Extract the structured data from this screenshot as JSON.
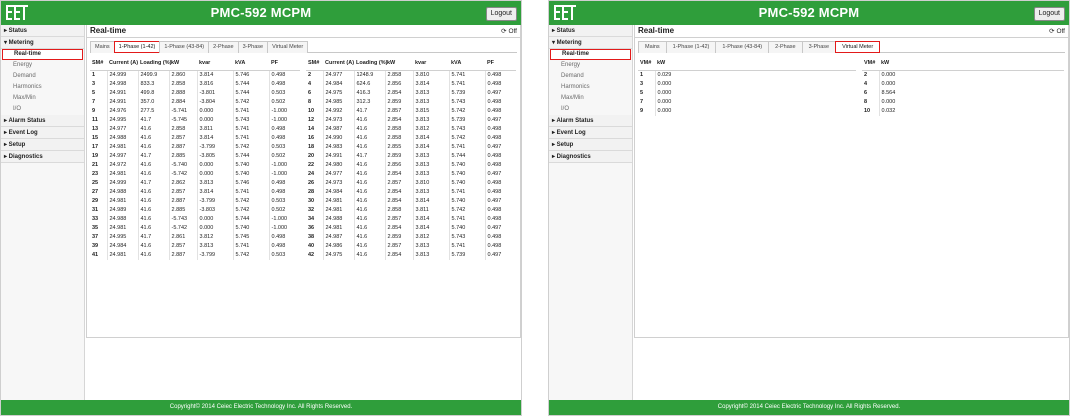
{
  "app": {
    "title": "PMC-592 MCPM",
    "logout_label": "Logout",
    "footer": "Copyright© 2014 Ceiec Electric Technology Inc. All Rights Reserved.",
    "brand_color": "#2f9e3b",
    "highlight_color": "#e21a1a"
  },
  "sidebar": {
    "status": "▸ Status",
    "metering": "▾ Metering",
    "metering_items": [
      "Real-time",
      "Energy",
      "Demand",
      "Harmonics",
      "Max/Min",
      "I/O"
    ],
    "alarm_status": "▸ Alarm Status",
    "event_log": "▸ Event Log",
    "setup": "▸ Setup",
    "diagnostics": "▸ Diagnostics"
  },
  "left": {
    "page_title": "Real-time",
    "refresh_label": "Off",
    "tabs": [
      "Mains",
      "1-Phase (1-42)",
      "1-Phase (43-84)",
      "2-Phase",
      "3-Phase",
      "Virtual Meter"
    ],
    "active_tab": "1-Phase (1-42)",
    "headers": [
      "SM#",
      "Current (A)",
      "Loading (%)",
      "kW",
      "kvar",
      "kVA",
      "PF"
    ],
    "rows": [
      [
        [
          "1",
          "24.999",
          "2499.9",
          "2.860",
          "3.814",
          "5.746",
          "0.498"
        ],
        [
          "2",
          "24.977",
          "1248.9",
          "2.858",
          "3.810",
          "5.741",
          "0.498"
        ]
      ],
      [
        [
          "3",
          "24.998",
          "833.3",
          "2.858",
          "3.816",
          "5.744",
          "0.498"
        ],
        [
          "4",
          "24.984",
          "624.6",
          "2.856",
          "3.814",
          "5.741",
          "0.498"
        ]
      ],
      [
        [
          "5",
          "24.991",
          "499.8",
          "2.888",
          "-3.801",
          "5.744",
          "0.503"
        ],
        [
          "6",
          "24.975",
          "416.3",
          "2.854",
          "3.813",
          "5.739",
          "0.497"
        ]
      ],
      [
        [
          "7",
          "24.991",
          "357.0",
          "2.884",
          "-3.804",
          "5.742",
          "0.502"
        ],
        [
          "8",
          "24.985",
          "312.3",
          "2.859",
          "3.813",
          "5.743",
          "0.498"
        ]
      ],
      [
        [
          "9",
          "24.976",
          "277.5",
          "-5.741",
          "0.000",
          "5.741",
          "-1.000"
        ],
        [
          "10",
          "24.992",
          "41.7",
          "2.857",
          "3.815",
          "5.742",
          "0.498"
        ]
      ],
      [
        [
          "11",
          "24.995",
          "41.7",
          "-5.745",
          "0.000",
          "5.743",
          "-1.000"
        ],
        [
          "12",
          "24.973",
          "41.6",
          "2.854",
          "3.813",
          "5.739",
          "0.497"
        ]
      ],
      [
        [
          "13",
          "24.977",
          "41.6",
          "2.858",
          "3.811",
          "5.741",
          "0.498"
        ],
        [
          "14",
          "24.987",
          "41.6",
          "2.858",
          "3.812",
          "5.743",
          "0.498"
        ]
      ],
      [
        [
          "15",
          "24.988",
          "41.6",
          "2.857",
          "3.814",
          "5.741",
          "0.498"
        ],
        [
          "16",
          "24.990",
          "41.6",
          "2.858",
          "3.814",
          "5.742",
          "0.498"
        ]
      ],
      [
        [
          "17",
          "24.981",
          "41.6",
          "2.887",
          "-3.799",
          "5.742",
          "0.503"
        ],
        [
          "18",
          "24.983",
          "41.6",
          "2.855",
          "3.814",
          "5.741",
          "0.497"
        ]
      ],
      [
        [
          "19",
          "24.997",
          "41.7",
          "2.885",
          "-3.805",
          "5.744",
          "0.502"
        ],
        [
          "20",
          "24.991",
          "41.7",
          "2.859",
          "3.813",
          "5.744",
          "0.498"
        ]
      ],
      [
        [
          "21",
          "24.972",
          "41.6",
          "-5.740",
          "0.000",
          "5.740",
          "-1.000"
        ],
        [
          "22",
          "24.980",
          "41.6",
          "2.856",
          "3.813",
          "5.740",
          "0.498"
        ]
      ],
      [
        [
          "23",
          "24.981",
          "41.6",
          "-5.742",
          "0.000",
          "5.740",
          "-1.000"
        ],
        [
          "24",
          "24.977",
          "41.6",
          "2.854",
          "3.813",
          "5.740",
          "0.497"
        ]
      ],
      [
        [
          "25",
          "24.999",
          "41.7",
          "2.862",
          "3.813",
          "5.746",
          "0.498"
        ],
        [
          "26",
          "24.973",
          "41.6",
          "2.857",
          "3.810",
          "5.740",
          "0.498"
        ]
      ],
      [
        [
          "27",
          "24.988",
          "41.6",
          "2.857",
          "3.814",
          "5.741",
          "0.498"
        ],
        [
          "28",
          "24.984",
          "41.6",
          "2.854",
          "3.813",
          "5.741",
          "0.498"
        ]
      ],
      [
        [
          "29",
          "24.981",
          "41.6",
          "2.887",
          "-3.799",
          "5.742",
          "0.503"
        ],
        [
          "30",
          "24.981",
          "41.6",
          "2.854",
          "3.814",
          "5.740",
          "0.497"
        ]
      ],
      [
        [
          "31",
          "24.989",
          "41.6",
          "2.885",
          "-3.803",
          "5.742",
          "0.502"
        ],
        [
          "32",
          "24.981",
          "41.6",
          "2.858",
          "3.811",
          "5.742",
          "0.498"
        ]
      ],
      [
        [
          "33",
          "24.988",
          "41.6",
          "-5.743",
          "0.000",
          "5.744",
          "-1.000"
        ],
        [
          "34",
          "24.988",
          "41.6",
          "2.857",
          "3.814",
          "5.741",
          "0.498"
        ]
      ],
      [
        [
          "35",
          "24.981",
          "41.6",
          "-5.742",
          "0.000",
          "5.740",
          "-1.000"
        ],
        [
          "36",
          "24.981",
          "41.6",
          "2.854",
          "3.814",
          "5.740",
          "0.497"
        ]
      ],
      [
        [
          "37",
          "24.995",
          "41.7",
          "2.861",
          "3.812",
          "5.745",
          "0.498"
        ],
        [
          "38",
          "24.987",
          "41.6",
          "2.859",
          "3.812",
          "5.743",
          "0.498"
        ]
      ],
      [
        [
          "39",
          "24.984",
          "41.6",
          "2.857",
          "3.813",
          "5.741",
          "0.498"
        ],
        [
          "40",
          "24.986",
          "41.6",
          "2.857",
          "3.813",
          "5.741",
          "0.498"
        ]
      ],
      [
        [
          "41",
          "24.981",
          "41.6",
          "2.887",
          "-3.799",
          "5.742",
          "0.503"
        ],
        [
          "42",
          "24.975",
          "41.6",
          "2.854",
          "3.813",
          "5.739",
          "0.497"
        ]
      ]
    ]
  },
  "right": {
    "page_title": "Real-time",
    "refresh_label": "Off",
    "tabs": [
      "Mains",
      "1-Phase (1-42)",
      "1-Phase (43-84)",
      "2-Phase",
      "3-Phase",
      "Virtual Meter"
    ],
    "active_tab": "Virtual Meter",
    "headers": [
      "VM#",
      "kW"
    ],
    "rows": [
      [
        [
          "1",
          "0.029"
        ],
        [
          "2",
          "0.000"
        ]
      ],
      [
        [
          "3",
          "0.000"
        ],
        [
          "4",
          "0.000"
        ]
      ],
      [
        [
          "5",
          "0.000"
        ],
        [
          "6",
          "8.564"
        ]
      ],
      [
        [
          "7",
          "0.000"
        ],
        [
          "8",
          "0.000"
        ]
      ],
      [
        [
          "9",
          "0.000"
        ],
        [
          "10",
          "0.032"
        ]
      ]
    ]
  }
}
